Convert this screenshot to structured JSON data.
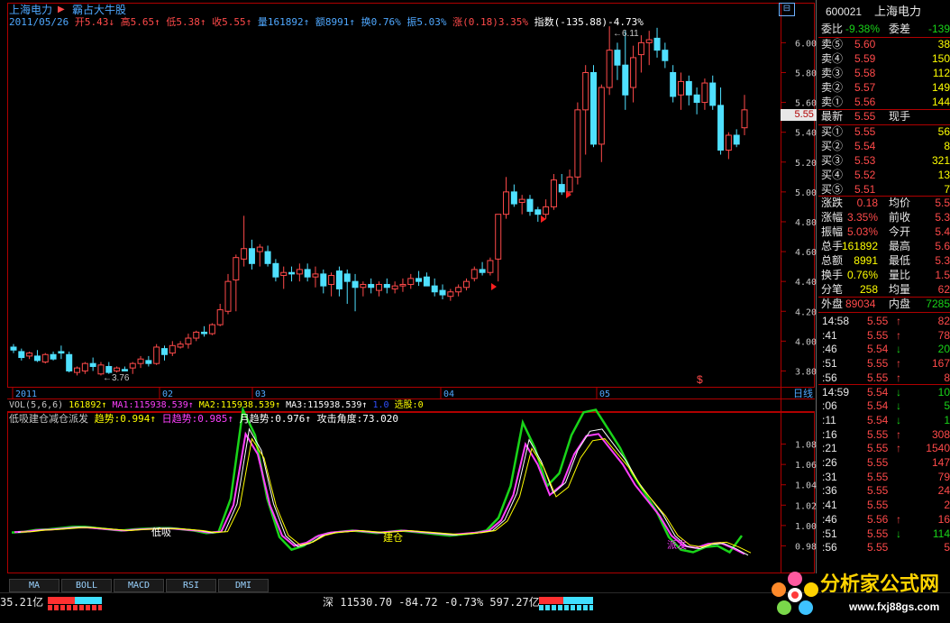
{
  "header": {
    "stock_name": "上海电力",
    "stock_name_color": "#4fa8ff",
    "indicator_name": "霸占大牛股",
    "date": "2011/05/26",
    "quote_items": [
      {
        "text": "开5.43↓",
        "color": "#ff4a4a"
      },
      {
        "text": "高5.65↑",
        "color": "#ff4a4a"
      },
      {
        "text": "低5.38↑",
        "color": "#ff4a4a"
      },
      {
        "text": "收5.55↑",
        "color": "#ff4a4a"
      },
      {
        "text": "量161892↑",
        "color": "#4fa8ff"
      },
      {
        "text": "额8991↑",
        "color": "#4fa8ff"
      },
      {
        "text": "换0.76%",
        "color": "#4fa8ff"
      },
      {
        "text": "振5.03%",
        "color": "#4fa8ff"
      },
      {
        "text": "涨(0.18)3.35%",
        "color": "#ff4a4a"
      },
      {
        "text": "指数(-135.88)-4.73%",
        "color": "#ffffff"
      }
    ]
  },
  "icons": {
    "layout_icon": "grid-layout-icon",
    "stock_arrow": "triangle-right-icon"
  },
  "chart_data": [
    {
      "type": "candlestick",
      "title": "上海电力 日线",
      "ylim": [
        3.7,
        6.25
      ],
      "y_ticks": [
        "6.00",
        "5.80",
        "5.60",
        "5.40",
        "5.20",
        "5.00",
        "4.80",
        "4.60",
        "4.40",
        "4.20",
        "4.00",
        "3.80"
      ],
      "current_price_tag": "5.55",
      "x_labels": [
        "2011",
        "02",
        "03",
        "04",
        "05"
      ],
      "period_label": "日线",
      "annotations": {
        "high": "6.11",
        "low": "3.76"
      },
      "up_color": "#ff4a4a",
      "down_color": "#4fe0ff",
      "candles": [
        [
          3.96,
          3.98,
          3.92,
          3.94
        ],
        [
          3.93,
          3.95,
          3.87,
          3.89
        ],
        [
          3.9,
          3.93,
          3.88,
          3.92
        ],
        [
          3.9,
          3.94,
          3.86,
          3.87
        ],
        [
          3.86,
          3.92,
          3.85,
          3.91
        ],
        [
          3.91,
          3.93,
          3.87,
          3.88
        ],
        [
          3.93,
          3.97,
          3.88,
          3.92
        ],
        [
          3.91,
          3.93,
          3.79,
          3.8
        ],
        [
          3.79,
          3.83,
          3.77,
          3.82
        ],
        [
          3.8,
          3.86,
          3.78,
          3.85
        ],
        [
          3.85,
          3.89,
          3.8,
          3.83
        ],
        [
          3.78,
          3.86,
          3.77,
          3.84
        ],
        [
          3.83,
          3.86,
          3.78,
          3.79
        ],
        [
          3.8,
          3.83,
          3.79,
          3.82
        ],
        [
          3.81,
          3.83,
          3.8,
          3.8
        ],
        [
          3.82,
          3.86,
          3.78,
          3.85
        ],
        [
          3.85,
          3.9,
          3.82,
          3.88
        ],
        [
          3.87,
          3.9,
          3.83,
          3.85
        ],
        [
          3.85,
          3.98,
          3.84,
          3.96
        ],
        [
          3.95,
          3.97,
          3.87,
          3.91
        ],
        [
          3.92,
          4.0,
          3.9,
          3.97
        ],
        [
          3.96,
          4.0,
          3.95,
          3.98
        ],
        [
          3.98,
          4.05,
          3.95,
          4.02
        ],
        [
          4.02,
          4.07,
          4.0,
          4.06
        ],
        [
          4.06,
          4.1,
          4.03,
          4.05
        ],
        [
          4.05,
          4.12,
          4.04,
          4.11
        ],
        [
          4.11,
          4.25,
          4.1,
          4.21
        ],
        [
          4.2,
          4.45,
          4.18,
          4.4
        ],
        [
          4.41,
          4.58,
          4.2,
          4.56
        ],
        [
          4.55,
          4.84,
          4.5,
          4.62
        ],
        [
          4.62,
          4.68,
          4.48,
          4.52
        ],
        [
          4.6,
          4.65,
          4.5,
          4.63
        ],
        [
          4.6,
          4.64,
          4.5,
          4.52
        ],
        [
          4.52,
          4.55,
          4.4,
          4.43
        ],
        [
          4.44,
          4.5,
          4.35,
          4.46
        ],
        [
          4.46,
          4.5,
          4.4,
          4.45
        ],
        [
          4.45,
          4.52,
          4.4,
          4.48
        ],
        [
          4.48,
          4.52,
          4.4,
          4.43
        ],
        [
          4.43,
          4.5,
          4.36,
          4.45
        ],
        [
          4.45,
          4.48,
          4.32,
          4.37
        ],
        [
          4.38,
          4.46,
          4.3,
          4.44
        ],
        [
          4.47,
          4.5,
          4.3,
          4.35
        ],
        [
          4.45,
          4.48,
          4.25,
          4.4
        ],
        [
          4.4,
          4.45,
          4.2,
          4.36
        ],
        [
          4.36,
          4.4,
          4.3,
          4.38
        ],
        [
          4.38,
          4.42,
          4.32,
          4.36
        ],
        [
          4.34,
          4.4,
          4.3,
          4.38
        ],
        [
          4.38,
          4.42,
          4.32,
          4.36
        ],
        [
          4.35,
          4.4,
          4.32,
          4.37
        ],
        [
          4.37,
          4.42,
          4.33,
          4.38
        ],
        [
          4.38,
          4.45,
          4.35,
          4.42
        ],
        [
          4.42,
          4.47,
          4.37,
          4.4
        ],
        [
          4.43,
          4.46,
          4.38,
          4.37
        ],
        [
          4.37,
          4.42,
          4.3,
          4.33
        ],
        [
          4.34,
          4.38,
          4.28,
          4.31
        ],
        [
          4.3,
          4.35,
          4.27,
          4.33
        ],
        [
          4.33,
          4.38,
          4.3,
          4.36
        ],
        [
          4.36,
          4.42,
          4.34,
          4.4
        ],
        [
          4.42,
          4.5,
          4.4,
          4.48
        ],
        [
          4.48,
          4.53,
          4.44,
          4.46
        ],
        [
          4.46,
          4.56,
          4.44,
          4.54
        ],
        [
          4.55,
          4.85,
          4.4,
          4.85
        ],
        [
          4.85,
          5.1,
          4.82,
          5.0
        ],
        [
          5.0,
          5.05,
          4.9,
          4.92
        ],
        [
          4.93,
          4.98,
          4.85,
          4.95
        ],
        [
          4.95,
          4.98,
          4.84,
          4.87
        ],
        [
          4.88,
          4.9,
          4.8,
          4.85
        ],
        [
          4.85,
          4.95,
          4.82,
          4.9
        ],
        [
          4.9,
          5.12,
          4.88,
          5.08
        ],
        [
          5.05,
          5.12,
          4.98,
          5.0
        ],
        [
          5.0,
          5.15,
          4.98,
          5.1
        ],
        [
          5.1,
          5.6,
          5.05,
          5.55
        ],
        [
          5.55,
          5.85,
          5.25,
          5.8
        ],
        [
          5.8,
          5.85,
          5.3,
          5.32
        ],
        [
          5.32,
          5.72,
          5.2,
          5.7
        ],
        [
          5.7,
          6.11,
          5.65,
          5.95
        ],
        [
          5.95,
          6.0,
          5.75,
          5.85
        ],
        [
          5.85,
          6.08,
          5.55,
          5.65
        ],
        [
          5.7,
          5.98,
          5.6,
          5.9
        ],
        [
          5.92,
          6.05,
          5.8,
          6.0
        ],
        [
          6.0,
          6.08,
          5.85,
          6.02
        ],
        [
          6.03,
          6.1,
          5.9,
          5.95
        ],
        [
          5.95,
          6.0,
          5.83,
          5.88
        ],
        [
          5.8,
          5.85,
          5.6,
          5.64
        ],
        [
          5.65,
          5.8,
          5.55,
          5.74
        ],
        [
          5.74,
          5.78,
          5.58,
          5.65
        ],
        [
          5.65,
          5.7,
          5.52,
          5.6
        ],
        [
          5.6,
          5.76,
          5.55,
          5.73
        ],
        [
          5.73,
          5.78,
          5.55,
          5.58
        ],
        [
          5.58,
          5.7,
          5.25,
          5.28
        ],
        [
          5.28,
          5.4,
          5.22,
          5.38
        ],
        [
          5.38,
          5.42,
          5.3,
          5.32
        ],
        [
          5.43,
          5.65,
          5.38,
          5.55
        ]
      ]
    },
    {
      "type": "line",
      "title": "低吸建仓减仓派发",
      "ylim": [
        0.96,
        1.1
      ],
      "y_ticks": [
        "1.08",
        "1.06",
        "1.04",
        "1.02",
        "1.00",
        "0.98"
      ],
      "series": [
        {
          "name": "趋势",
          "value_label": "0.994",
          "color": "#ff40ff"
        },
        {
          "name": "日趋势",
          "value_label": "0.985",
          "color": "#ffffff"
        },
        {
          "name": "月趋势",
          "value_label": "0.976",
          "color": "#ffff00"
        }
      ],
      "attack_angle": "73.020",
      "labels": [
        {
          "text": "低吸",
          "color": "#ffffff"
        },
        {
          "text": "建仓",
          "color": "#ffff00"
        },
        {
          "text": "派发",
          "color": "#ff40ff"
        }
      ]
    }
  ],
  "volume_bar": {
    "label": "VOL(5,6,6)",
    "value": "161892↑",
    "ma1": "MA1:115938.539↑",
    "ma2": "MA2:115938.539↑",
    "ma3": "MA3:115938.539↑",
    "extra": "1.0",
    "select": "选股:0"
  },
  "indicator_header": {
    "name": "低吸建仓减仓派发",
    "trend": "趋势:0.994↑",
    "day_trend": "日趋势:0.985↑",
    "month_trend": "月趋势:0.976↑",
    "angle": "攻击角度:73.020"
  },
  "tabs": [
    "MA",
    "BOLL",
    "MACD",
    "RSI",
    "DMI"
  ],
  "status": {
    "left_value": "35.21亿",
    "index_text": "深 11530.70 -84.72 -0.73% 597.27亿"
  },
  "right_panel": {
    "code": "600021",
    "name": "上海电力",
    "weibi": {
      "label": "委比",
      "value": "-9.38%",
      "label2": "委差",
      "value2": "-139"
    },
    "sell": [
      {
        "label": "卖⑤",
        "price": "5.60",
        "vol": "38"
      },
      {
        "label": "卖④",
        "price": "5.59",
        "vol": "150"
      },
      {
        "label": "卖③",
        "price": "5.58",
        "vol": "112"
      },
      {
        "label": "卖②",
        "price": "5.57",
        "vol": "149"
      },
      {
        "label": "卖①",
        "price": "5.56",
        "vol": "144"
      }
    ],
    "last": {
      "label": "最新",
      "price": "5.55",
      "label2": "现手"
    },
    "buy": [
      {
        "label": "买①",
        "price": "5.55",
        "vol": "56"
      },
      {
        "label": "买②",
        "price": "5.54",
        "vol": "8"
      },
      {
        "label": "买③",
        "price": "5.53",
        "vol": "321"
      },
      {
        "label": "买④",
        "price": "5.52",
        "vol": "13"
      },
      {
        "label": "买⑤",
        "price": "5.51",
        "vol": "7"
      }
    ],
    "stats": [
      {
        "l1": "涨跌",
        "v1": "0.18",
        "l2": "均价",
        "v2": "5.5"
      },
      {
        "l1": "涨幅",
        "v1": "3.35%",
        "l2": "前收",
        "v2": "5.3"
      },
      {
        "l1": "振幅",
        "v1": "5.03%",
        "l2": "今开",
        "v2": "5.4"
      },
      {
        "l1": "总手",
        "v1": "161892",
        "l2": "最高",
        "v2": "5.6"
      },
      {
        "l1": "总额",
        "v1": "8991",
        "l2": "最低",
        "v2": "5.3"
      },
      {
        "l1": "换手",
        "v1": "0.76%",
        "l2": "量比",
        "v2": "1.5"
      },
      {
        "l1": "分笔",
        "v1": "258",
        "l2": "均量",
        "v2": "62"
      }
    ],
    "inout": {
      "l1": "外盘",
      "v1": "89034",
      "l2": "内盘",
      "v2": "7285"
    },
    "ticks": [
      {
        "t": "14:58",
        "p": "5.55",
        "a": "↑",
        "v": "82",
        "up": true
      },
      {
        "t": ":41",
        "p": "5.55",
        "a": "↑",
        "v": "78",
        "up": true
      },
      {
        "t": ":46",
        "p": "5.54",
        "a": "↓",
        "v": "20",
        "up": false
      },
      {
        "t": ":51",
        "p": "5.55",
        "a": "↑",
        "v": "167",
        "up": true
      },
      {
        "t": ":56",
        "p": "5.55",
        "a": "↑",
        "v": "8",
        "up": true
      },
      {
        "t": "14:59",
        "p": "5.54",
        "a": "↓",
        "v": "10",
        "up": false
      },
      {
        "t": ":06",
        "p": "5.54",
        "a": "↓",
        "v": "5",
        "up": false
      },
      {
        "t": ":11",
        "p": "5.54",
        "a": "↓",
        "v": "1",
        "up": false
      },
      {
        "t": ":16",
        "p": "5.55",
        "a": "↑",
        "v": "308",
        "up": true
      },
      {
        "t": ":21",
        "p": "5.55",
        "a": "↑",
        "v": "1540",
        "up": true
      },
      {
        "t": ":26",
        "p": "5.55",
        "a": "",
        "v": "147",
        "up": true
      },
      {
        "t": ":31",
        "p": "5.55",
        "a": "",
        "v": "79",
        "up": true
      },
      {
        "t": ":36",
        "p": "5.55",
        "a": "",
        "v": "24",
        "up": true
      },
      {
        "t": ":41",
        "p": "5.55",
        "a": "",
        "v": "2",
        "up": true
      },
      {
        "t": ":46",
        "p": "5.56",
        "a": "↑",
        "v": "16",
        "up": true
      },
      {
        "t": ":51",
        "p": "5.55",
        "a": "↓",
        "v": "114",
        "up": false
      },
      {
        "t": ":56",
        "p": "5.55",
        "a": "",
        "v": "5",
        "up": true
      }
    ]
  },
  "watermark": {
    "text": "分析家公式网",
    "url": "www.fxj88gs.com"
  }
}
